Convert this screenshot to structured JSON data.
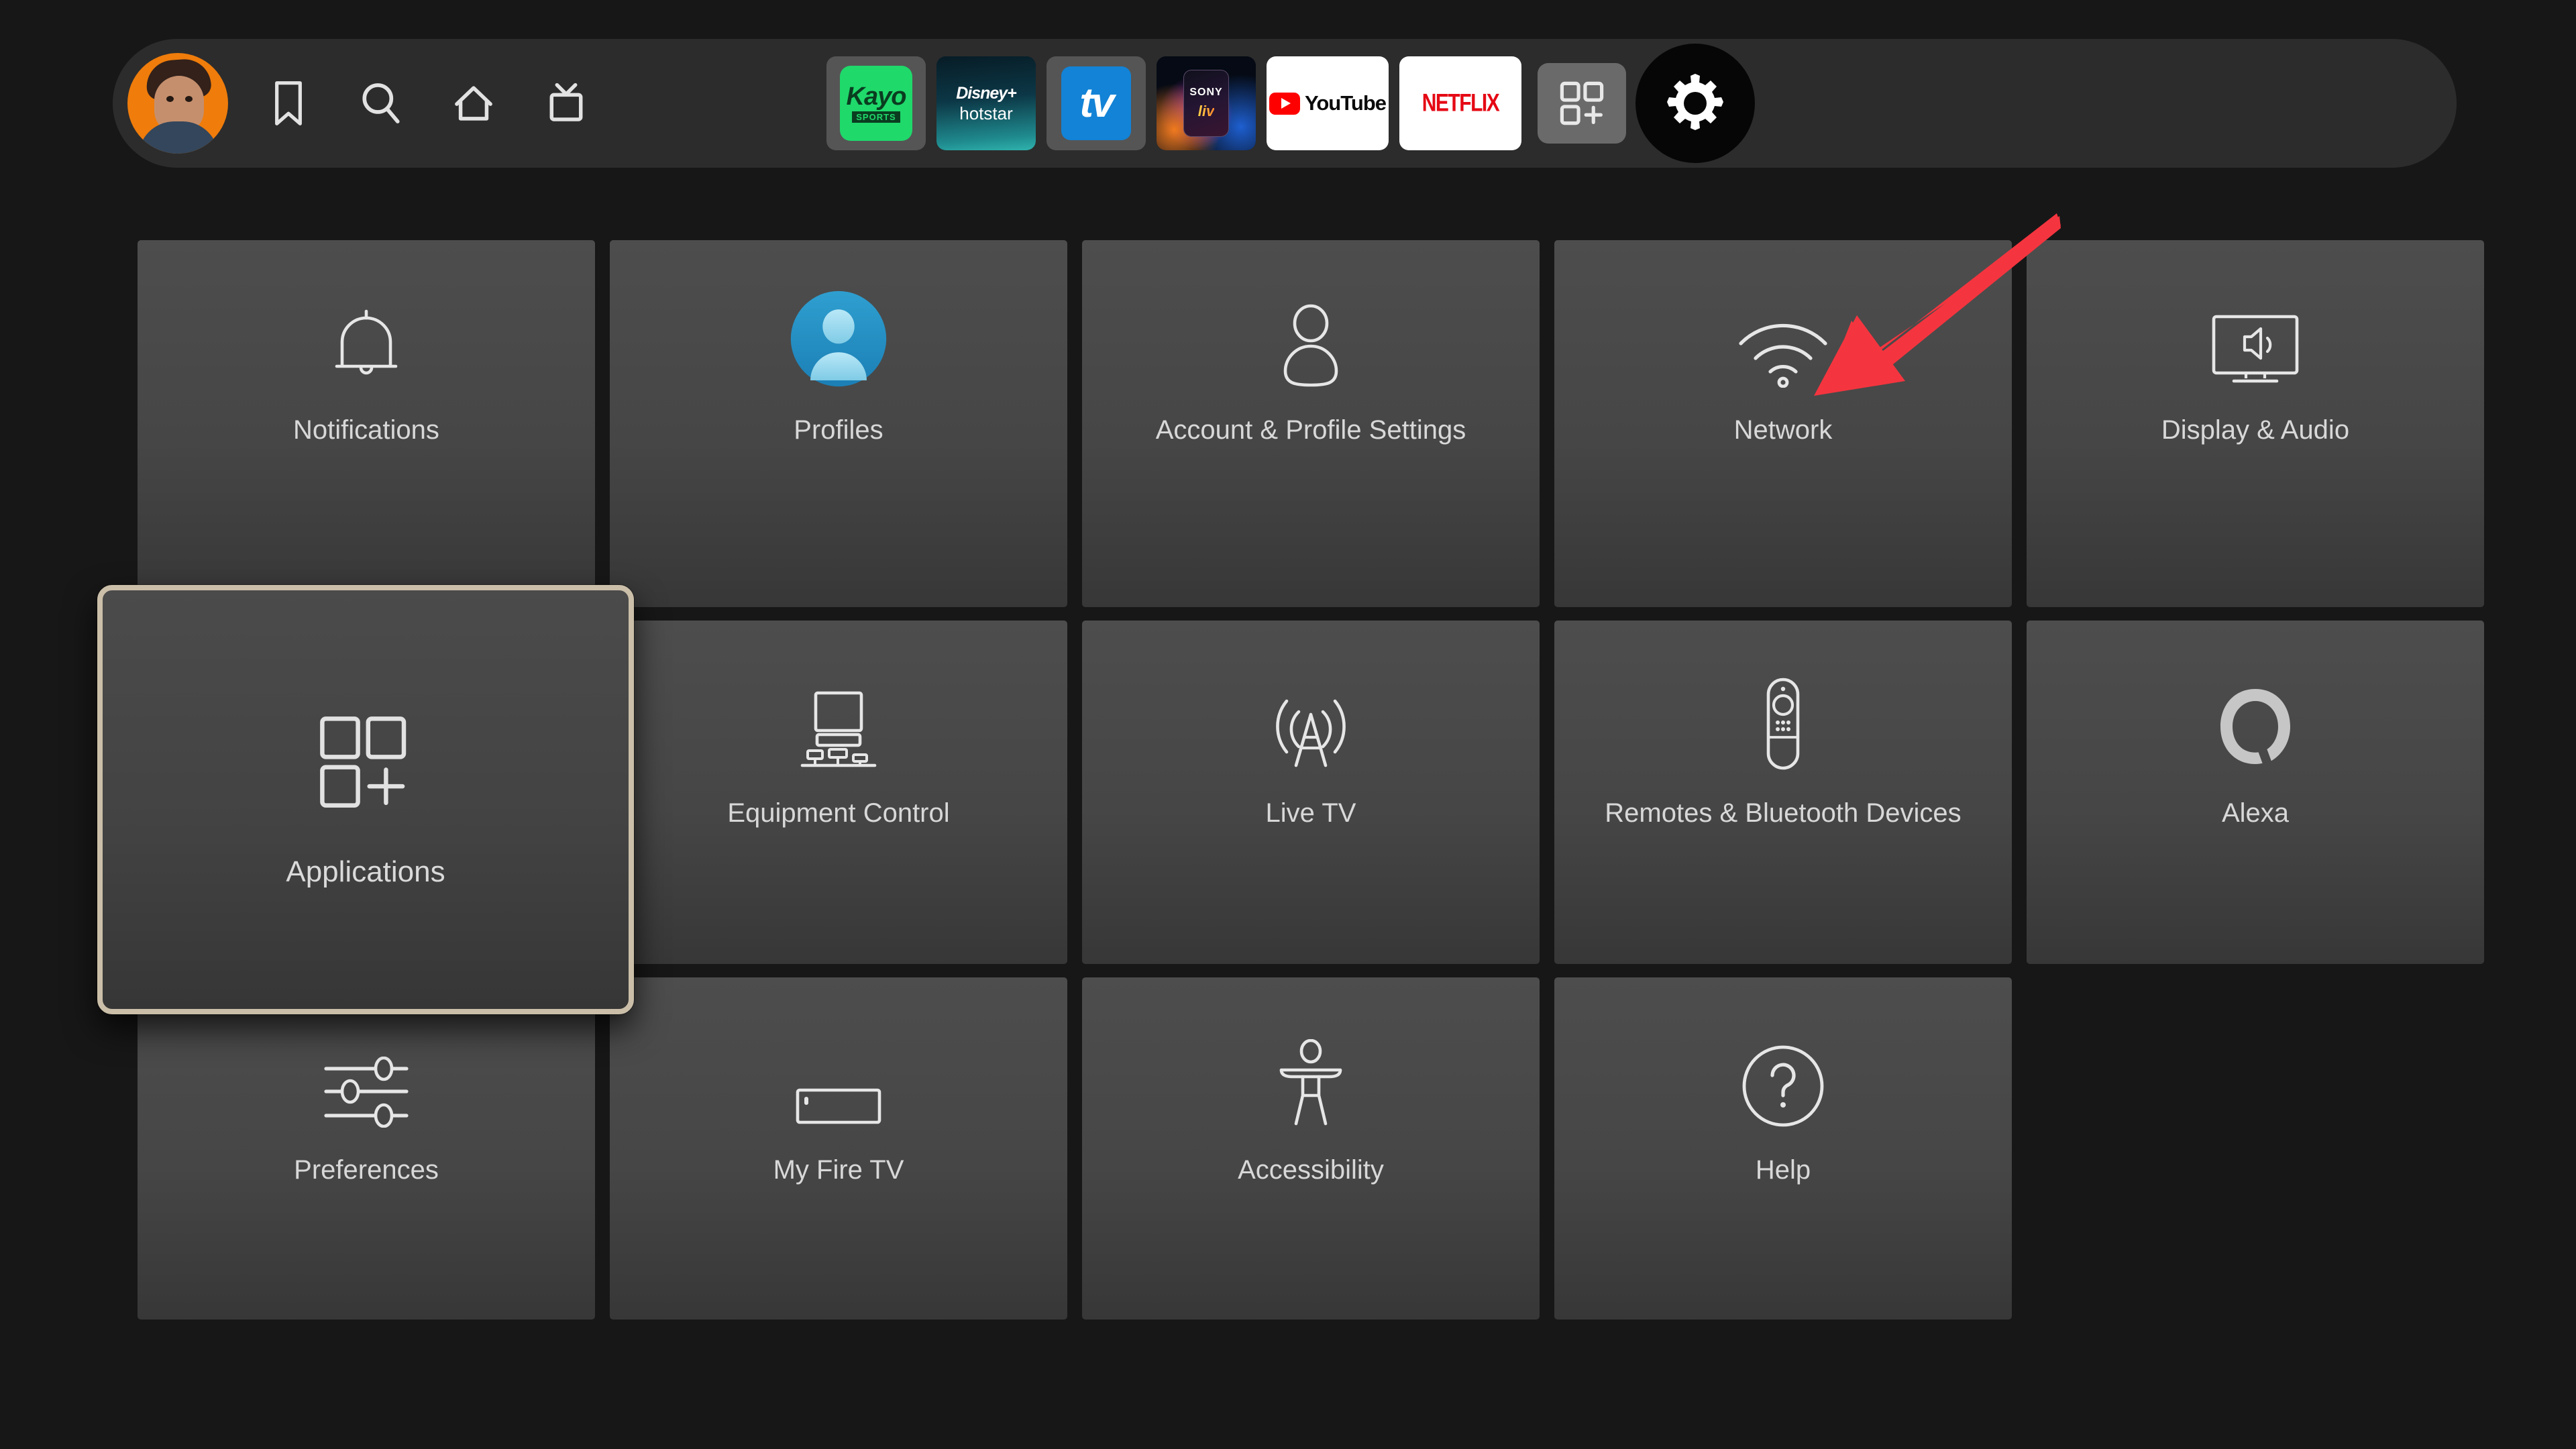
{
  "topbar": {
    "avatar": {
      "name": "user-avatar",
      "background_color": "#EF7C0B"
    },
    "nav_icons": [
      {
        "name": "bookmark-icon",
        "label": "Watchlist"
      },
      {
        "name": "search-icon",
        "label": "Search"
      },
      {
        "name": "home-icon",
        "label": "Home"
      },
      {
        "name": "live-tv-icon",
        "label": "Live"
      }
    ],
    "apps": [
      {
        "name": "kayo-sports-app",
        "label": "Kayo",
        "sublabel": "SPORTS",
        "color": "#1FD96B"
      },
      {
        "name": "disney-hotstar-app",
        "label": "Disney+",
        "sublabel": "hotstar",
        "color": "#0c3746"
      },
      {
        "name": "tv-app",
        "label": "tv",
        "color": "#1283D6"
      },
      {
        "name": "sony-liv-app",
        "label": "SONY",
        "sublabel": "liv",
        "color": "#050a14"
      },
      {
        "name": "youtube-app",
        "label": "YouTube",
        "color": "#FF0000"
      },
      {
        "name": "netflix-app",
        "label": "NETFLIX",
        "color": "#E50914"
      }
    ],
    "apps_grid_button": {
      "name": "apps-grid-button",
      "label": "Apps"
    },
    "settings_button": {
      "name": "settings-gear-button",
      "label": "Settings"
    }
  },
  "settings_grid": {
    "rows": [
      [
        {
          "id": "notifications",
          "label": "Notifications",
          "icon": "bell-icon"
        },
        {
          "id": "profiles",
          "label": "Profiles",
          "icon": "profile-avatar-icon"
        },
        {
          "id": "account",
          "label": "Account & Profile Settings",
          "icon": "person-icon"
        },
        {
          "id": "network",
          "label": "Network",
          "icon": "wifi-icon"
        },
        {
          "id": "display-audio",
          "label": "Display & Audio",
          "icon": "tv-speaker-icon"
        }
      ],
      [
        {
          "id": "applications",
          "label": "Applications",
          "icon": "apps-grid-icon"
        },
        {
          "id": "equipment",
          "label": "Equipment Control",
          "icon": "equipment-icon"
        },
        {
          "id": "live-tv",
          "label": "Live TV",
          "icon": "antenna-tower-icon"
        },
        {
          "id": "remotes",
          "label": "Remotes & Bluetooth Devices",
          "icon": "remote-control-icon"
        },
        {
          "id": "alexa",
          "label": "Alexa",
          "icon": "alexa-ring-icon"
        }
      ],
      [
        {
          "id": "preferences",
          "label": "Preferences",
          "icon": "sliders-icon"
        },
        {
          "id": "my-fire-tv",
          "label": "My Fire TV",
          "icon": "fire-stick-icon"
        },
        {
          "id": "accessibility",
          "label": "Accessibility",
          "icon": "accessibility-icon"
        },
        {
          "id": "help",
          "label": "Help",
          "icon": "question-mark-icon"
        }
      ]
    ],
    "focused_item": "applications",
    "focus_border_color": "#CBBFA9"
  },
  "annotation": {
    "arrow": {
      "name": "red-pointer-arrow",
      "color": "#F4353F",
      "points_to": "network"
    }
  }
}
